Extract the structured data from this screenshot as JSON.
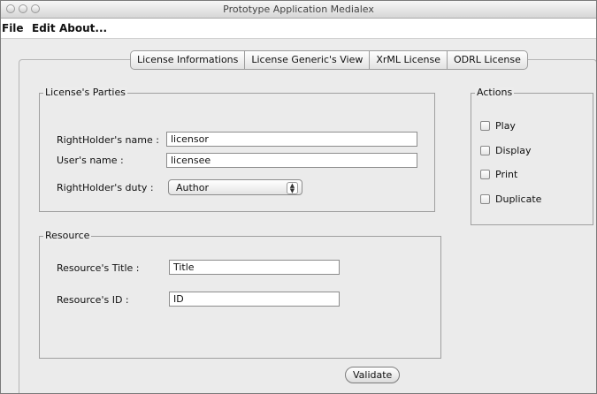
{
  "window": {
    "title": "Prototype Application Medialex"
  },
  "menu": {
    "items": [
      "File",
      "Edit",
      "About..."
    ]
  },
  "tabs": [
    "License Informations",
    "License Generic's View",
    "XrML License",
    "ODRL License"
  ],
  "parties": {
    "legend": "License's Parties",
    "rightholder_name_label": "RightHolder's name :",
    "rightholder_name_value": "licensor",
    "user_name_label": "User's name :",
    "user_name_value": "licensee",
    "duty_label": "RightHolder's duty :",
    "duty_value": "Author"
  },
  "resource": {
    "legend": "Resource",
    "title_label": "Resource's Title :",
    "title_value": "Title",
    "id_label": "Resource's ID :",
    "id_value": "ID"
  },
  "actions": {
    "legend": "Actions",
    "items": [
      "Play",
      "Display",
      "Print",
      "Duplicate"
    ]
  },
  "validate_label": "Validate"
}
